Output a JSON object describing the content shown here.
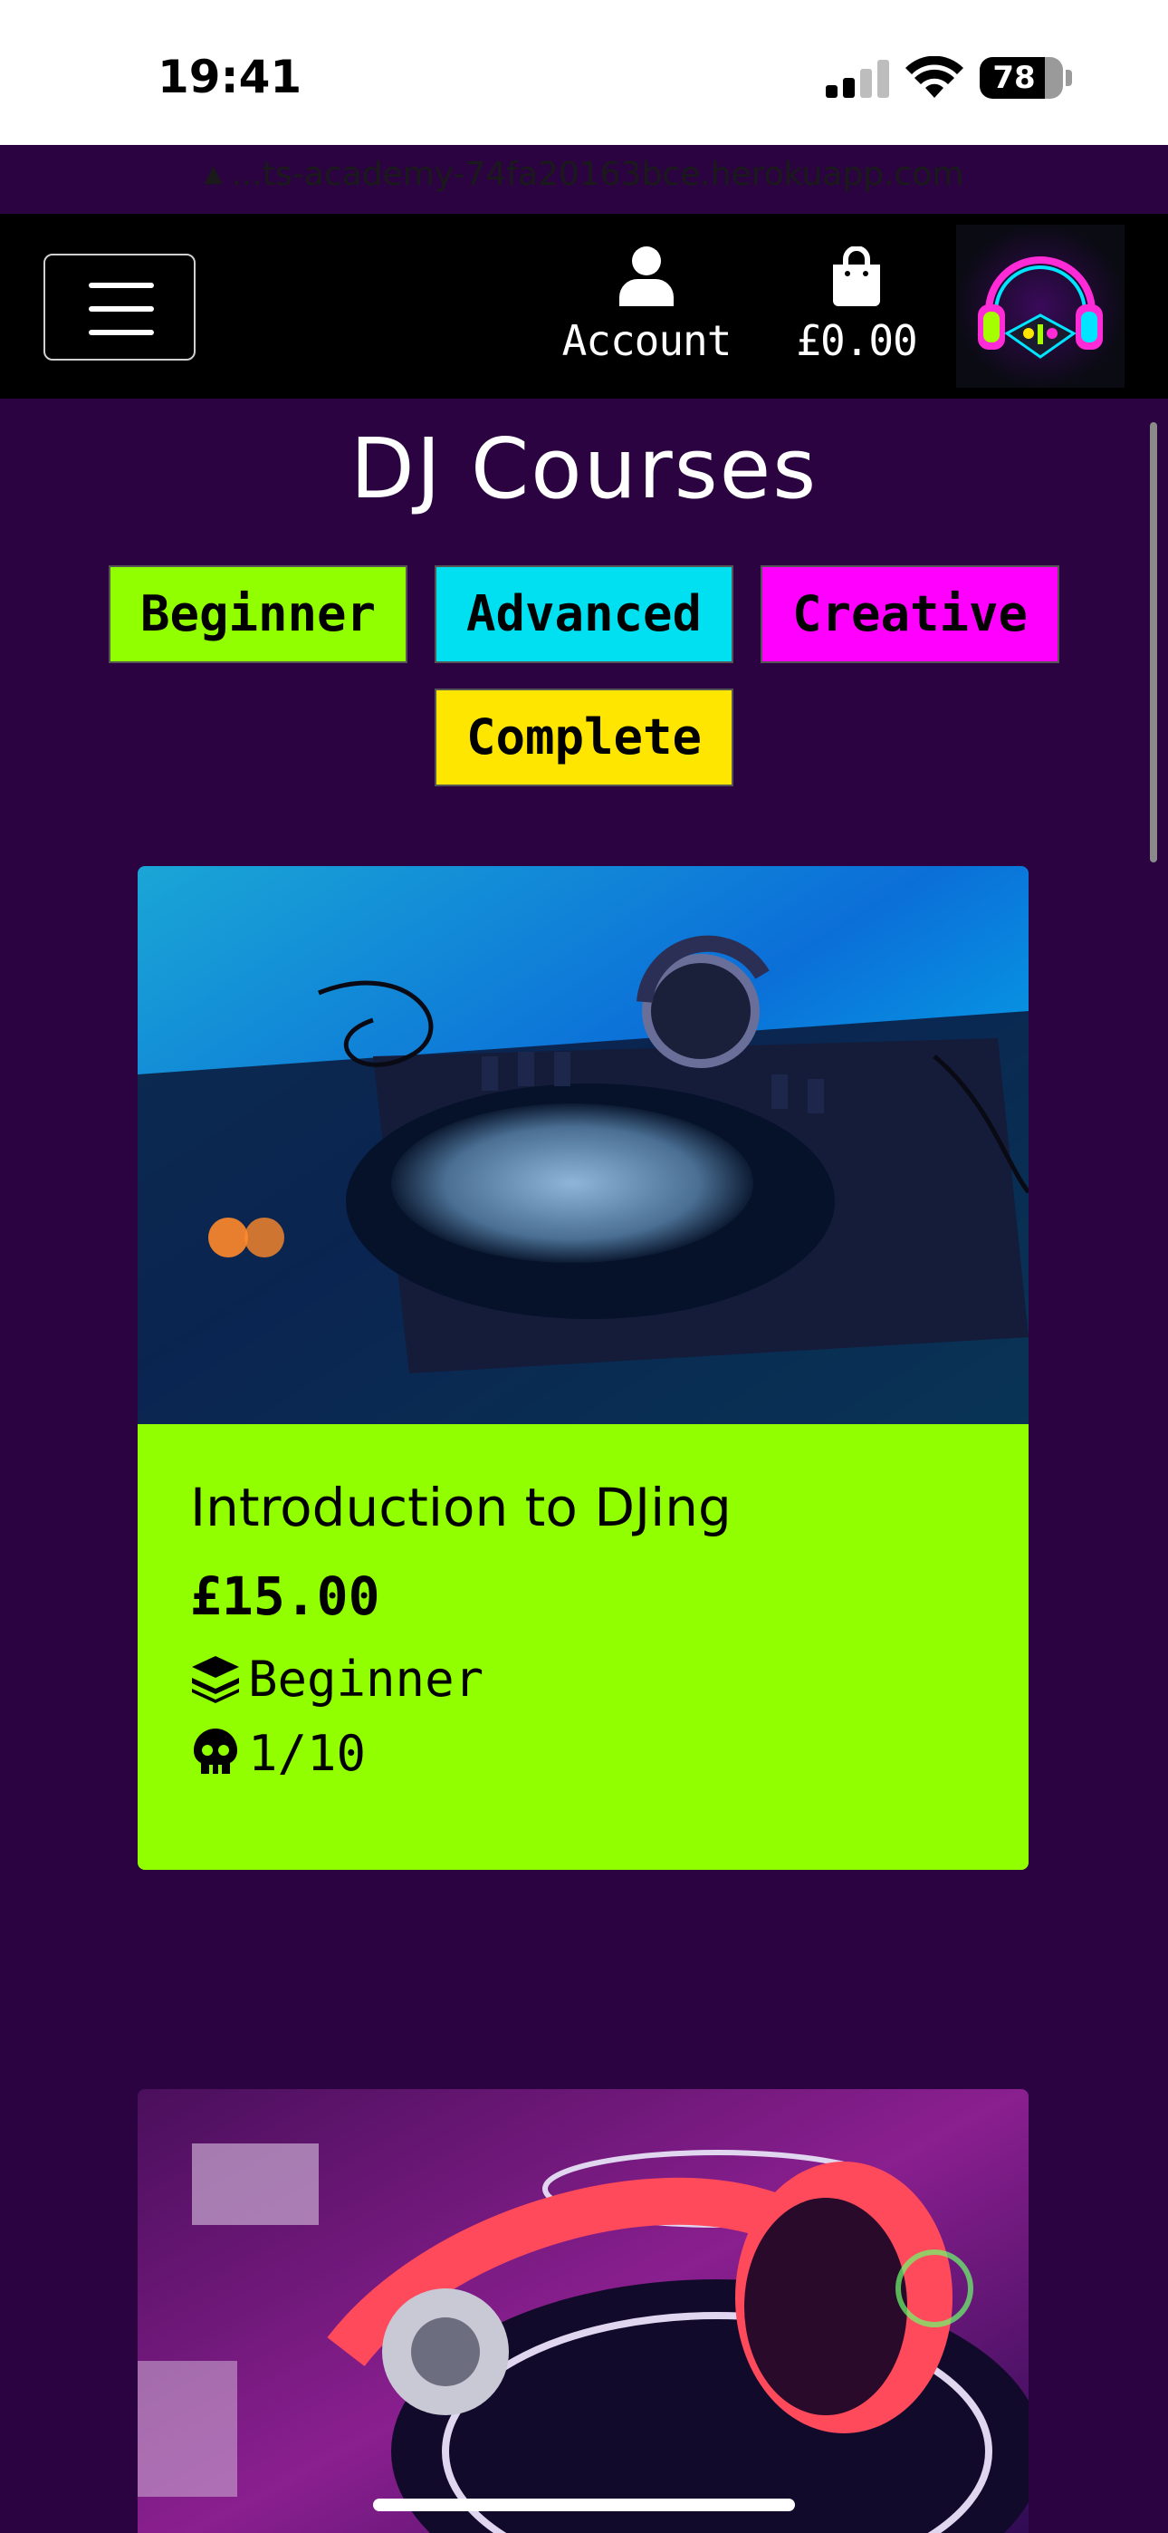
{
  "status_bar": {
    "time": "19:41",
    "battery_percent": 78,
    "battery_label": "78"
  },
  "browser": {
    "url": "...ts-academy-74fa20163bce.herokuapp.com",
    "warning_icon": "warning-triangle-icon"
  },
  "nav": {
    "menu_icon": "hamburger-menu-icon",
    "account_label": "Account",
    "bag_total": "£0.00",
    "account_icon": "user-icon",
    "bag_icon": "shopping-bag-icon",
    "logo_icon": "headphones-logo-icon"
  },
  "page": {
    "title": "DJ Courses"
  },
  "filters": [
    {
      "label": "Beginner",
      "color": "#91ff00"
    },
    {
      "label": "Advanced",
      "color": "#00e0f0"
    },
    {
      "label": "Creative",
      "color": "#ff00ff"
    },
    {
      "label": "Complete",
      "color": "#ffe600"
    }
  ],
  "courses": [
    {
      "title": "Introduction to DJing",
      "price": "£15.00",
      "level": "Beginner",
      "level_icon": "layer-group-icon",
      "count": "1/10",
      "count_icon": "skull-icon",
      "card_color": "#91ff00",
      "image": "dj-controller-blue-photo"
    },
    {
      "image": "dj-turntable-pink-headphones-photo"
    }
  ],
  "colors": {
    "page_bg": "#2a0340",
    "navbar_bg": "#000000",
    "beginner": "#91ff00",
    "advanced": "#00e0f0",
    "creative": "#ff00ff",
    "complete": "#ffe600"
  }
}
